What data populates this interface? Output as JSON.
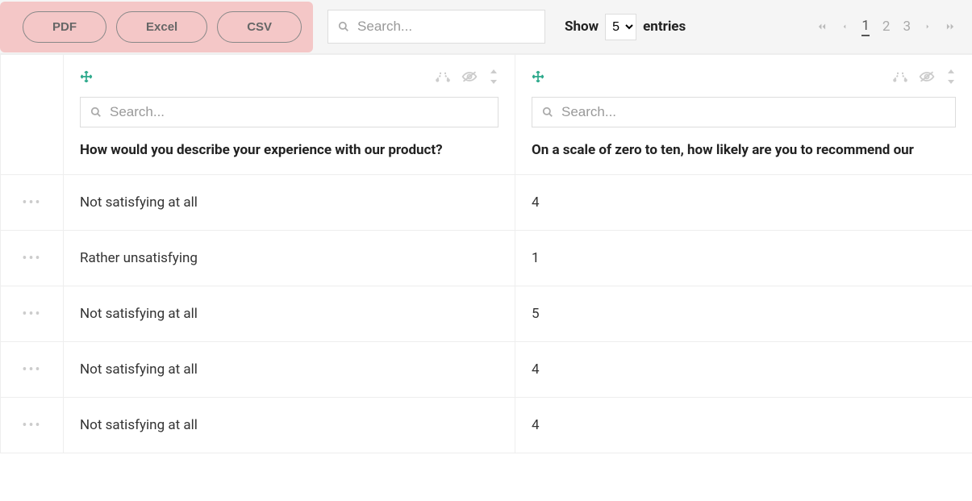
{
  "toolbar": {
    "export": {
      "pdf": "PDF",
      "excel": "Excel",
      "csv": "CSV"
    },
    "search_placeholder": "Search...",
    "show_label": "Show",
    "entries_label": "entries",
    "entries_value": "5",
    "pages": [
      "1",
      "2",
      "3"
    ],
    "active_page": "1"
  },
  "columns": [
    {
      "title": "How would you describe your experience with our product?",
      "search_placeholder": "Search..."
    },
    {
      "title": "On a scale of zero to ten, how likely are you to recommend our",
      "search_placeholder": "Search..."
    }
  ],
  "rows": [
    {
      "c1": "Not satisfying at all",
      "c2": "4"
    },
    {
      "c1": "Rather unsatisfying",
      "c2": "1"
    },
    {
      "c1": "Not satisfying at all",
      "c2": "5"
    },
    {
      "c1": "Not satisfying at all",
      "c2": "4"
    },
    {
      "c1": "Not satisfying at all",
      "c2": "4"
    }
  ]
}
